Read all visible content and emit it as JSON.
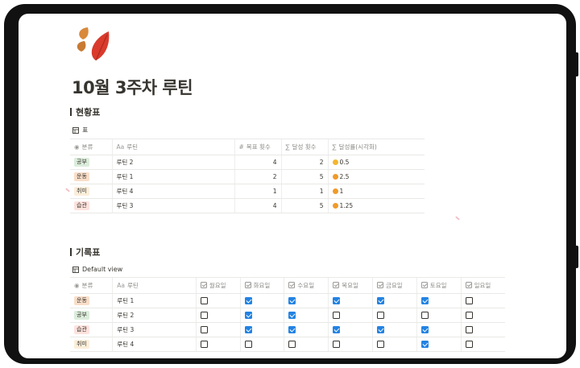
{
  "page": {
    "title": "10월 3주차 루틴",
    "icon": "autumn-leaves-icon"
  },
  "colors": {
    "tag_study_bg": "#dbeddb",
    "tag_exercise_bg": "#fadec9",
    "tag_hobby_bg": "#fbeeda",
    "tag_habit_bg": "#ffe2dd",
    "checkbox_checked": "#2383e2",
    "leaf_orange": "#d9893c",
    "leaf_red": "#d93a2b"
  },
  "status_section": {
    "heading": "현황표",
    "view_label": "표",
    "columns": {
      "category": "분류",
      "routine": "루틴",
      "target": "목표 횟수",
      "achieved": "달성 횟수",
      "rate": "달성률(시각화)"
    },
    "rows": [
      {
        "category": "공부",
        "tag_color": "#dbeddb",
        "routine": "루틴 2",
        "target": "4",
        "achieved": "2",
        "rate": "0.5",
        "face": "smile"
      },
      {
        "category": "운동",
        "tag_color": "#fadec9",
        "routine": "루틴 1",
        "target": "2",
        "achieved": "5",
        "rate": "2.5",
        "face": "grin"
      },
      {
        "category": "취미",
        "tag_color": "#fbeeda",
        "routine": "루틴 4",
        "target": "1",
        "achieved": "1",
        "rate": "1",
        "face": "grin"
      },
      {
        "category": "습관",
        "tag_color": "#ffe2dd",
        "routine": "루틴 3",
        "target": "4",
        "achieved": "5",
        "rate": "1.25",
        "face": "grin"
      }
    ]
  },
  "record_section": {
    "heading": "기록표",
    "view_label": "Default view",
    "columns": {
      "category": "분류",
      "routine": "루틴",
      "days": [
        "월요일",
        "화요일",
        "수요일",
        "목요일",
        "금요일",
        "토요일",
        "일요일"
      ]
    },
    "rows": [
      {
        "category": "운동",
        "tag_color": "#fadec9",
        "routine": "루틴 1",
        "checks": [
          false,
          true,
          true,
          true,
          true,
          true,
          false
        ]
      },
      {
        "category": "공부",
        "tag_color": "#dbeddb",
        "routine": "루틴 2",
        "checks": [
          false,
          true,
          true,
          false,
          false,
          false,
          false
        ]
      },
      {
        "category": "습관",
        "tag_color": "#ffe2dd",
        "routine": "루틴 3",
        "checks": [
          false,
          true,
          true,
          true,
          true,
          true,
          false
        ]
      },
      {
        "category": "취미",
        "tag_color": "#fbeeda",
        "routine": "루틴 4",
        "checks": [
          false,
          false,
          false,
          false,
          false,
          true,
          false
        ]
      }
    ]
  }
}
